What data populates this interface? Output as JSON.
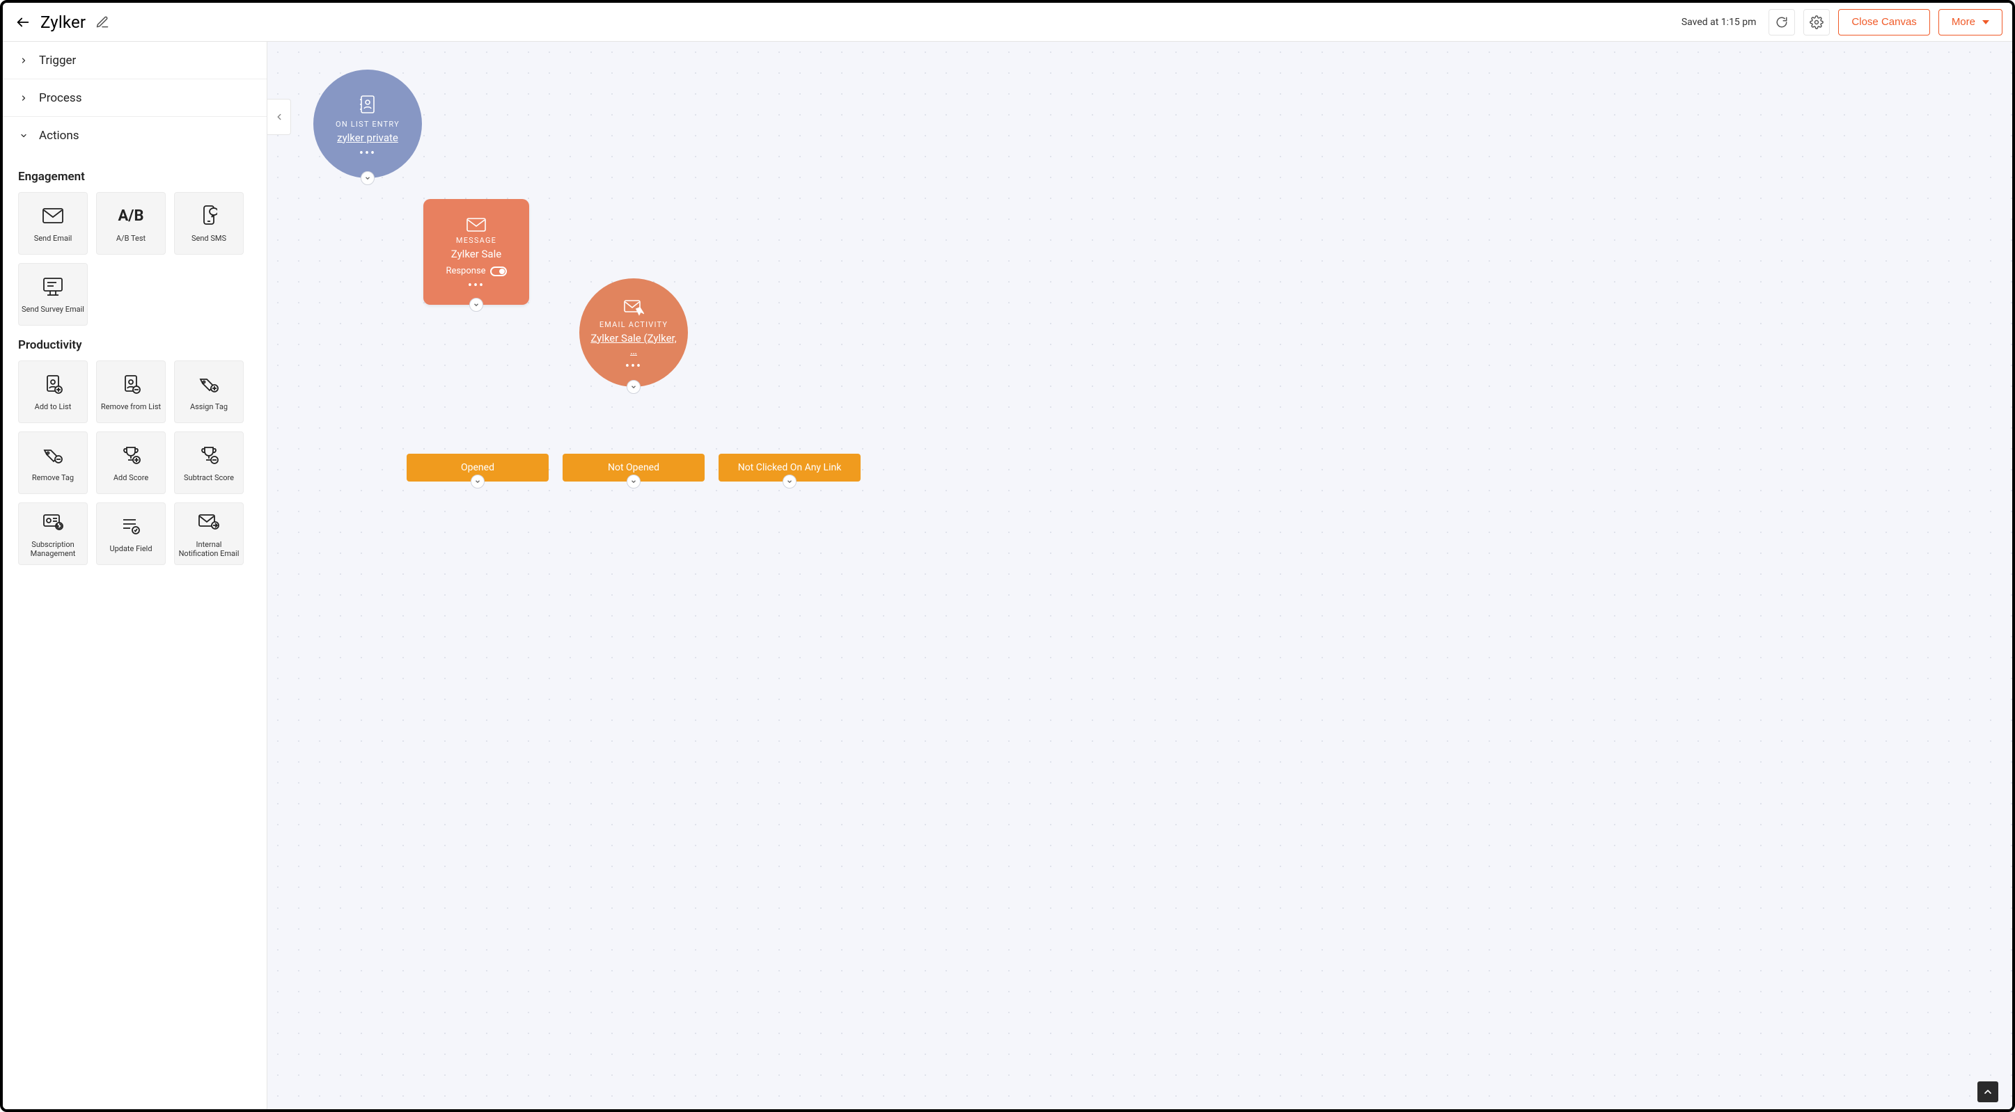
{
  "header": {
    "title": "Zylker",
    "saved_text": "Saved at 1:15 pm",
    "close_canvas_label": "Close Canvas",
    "more_label": "More"
  },
  "sidebar": {
    "rows": {
      "trigger_label": "Trigger",
      "process_label": "Process",
      "actions_label": "Actions"
    },
    "sections": {
      "engagement": {
        "title": "Engagement",
        "tiles": {
          "send_email": "Send Email",
          "ab_test": "A/B Test",
          "ab_icon_text": "A/B",
          "send_sms": "Send SMS",
          "send_survey_email": "Send Survey Email"
        }
      },
      "productivity": {
        "title": "Productivity",
        "tiles": {
          "add_to_list": "Add to List",
          "remove_from_list": "Remove from List",
          "assign_tag": "Assign Tag",
          "remove_tag": "Remove Tag",
          "add_score": "Add Score",
          "subtract_score": "Subtract Score",
          "subscription_management": "Subscription Management",
          "update_field": "Update Field",
          "internal_notification_email": "Internal Notification Email"
        }
      }
    }
  },
  "canvas": {
    "trigger_node": {
      "kicker": "ON LIST ENTRY",
      "name": "zylker private"
    },
    "message_node": {
      "kicker": "MESSAGE",
      "name": "Zylker Sale",
      "response_label": "Response"
    },
    "activity_node": {
      "kicker": "EMAIL ACTIVITY",
      "name": "Zylker Sale (Zylker, …"
    },
    "branches": {
      "opened": "Opened",
      "not_opened": "Not Opened",
      "not_clicked": "Not Clicked On Any Link"
    }
  },
  "colors": {
    "accent": "#f05a28",
    "trigger": "#8797c4",
    "message": "#e8805f",
    "activity": "#e1845e",
    "branch": "#f09b1e",
    "connector_blue": "#8a99c5",
    "connector_orange": "#f0a03a"
  }
}
